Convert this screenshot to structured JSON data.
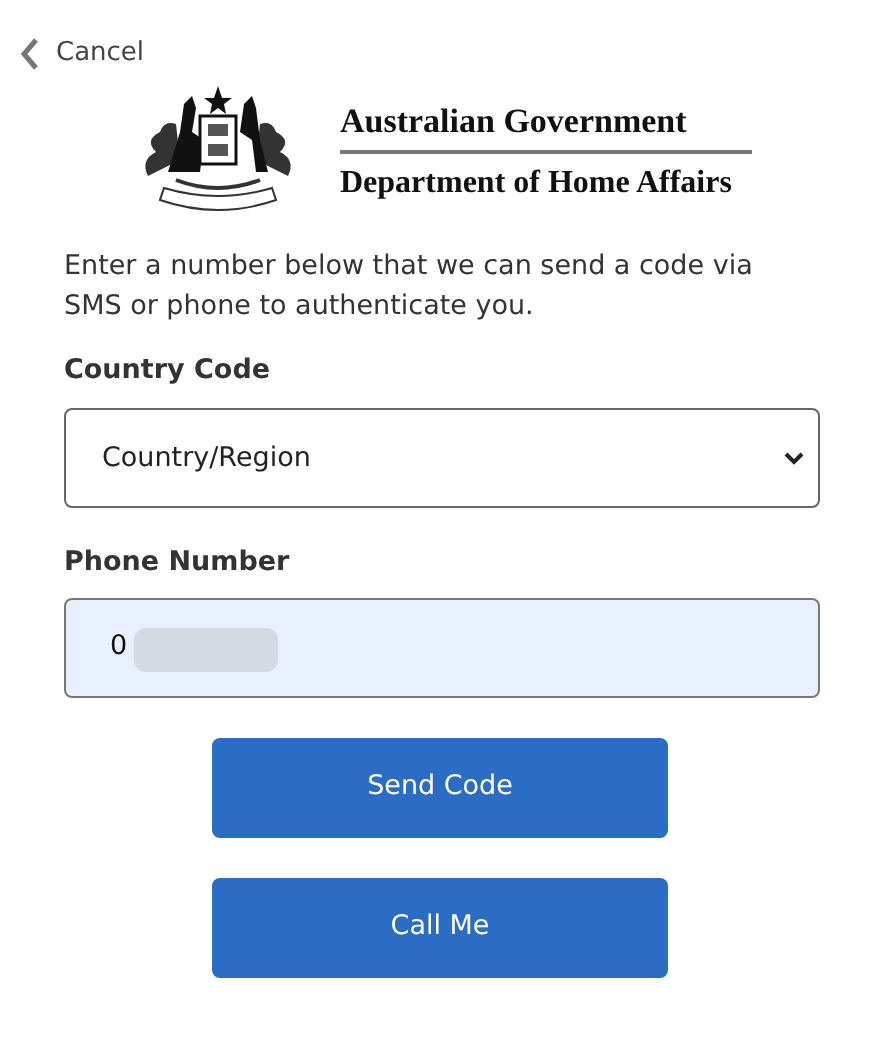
{
  "header": {
    "back_link": "Cancel",
    "agency": "Australian Government",
    "department": "Department of Home Affairs"
  },
  "instructions": "Enter a number below that we can send a code via SMS or phone to authenticate you.",
  "country_code": {
    "label": "Country Code",
    "value": "Country/Region"
  },
  "phone_number": {
    "label": "Phone Number",
    "value": "0",
    "redacted": true
  },
  "buttons": [
    "Send Code",
    "Call Me"
  ]
}
